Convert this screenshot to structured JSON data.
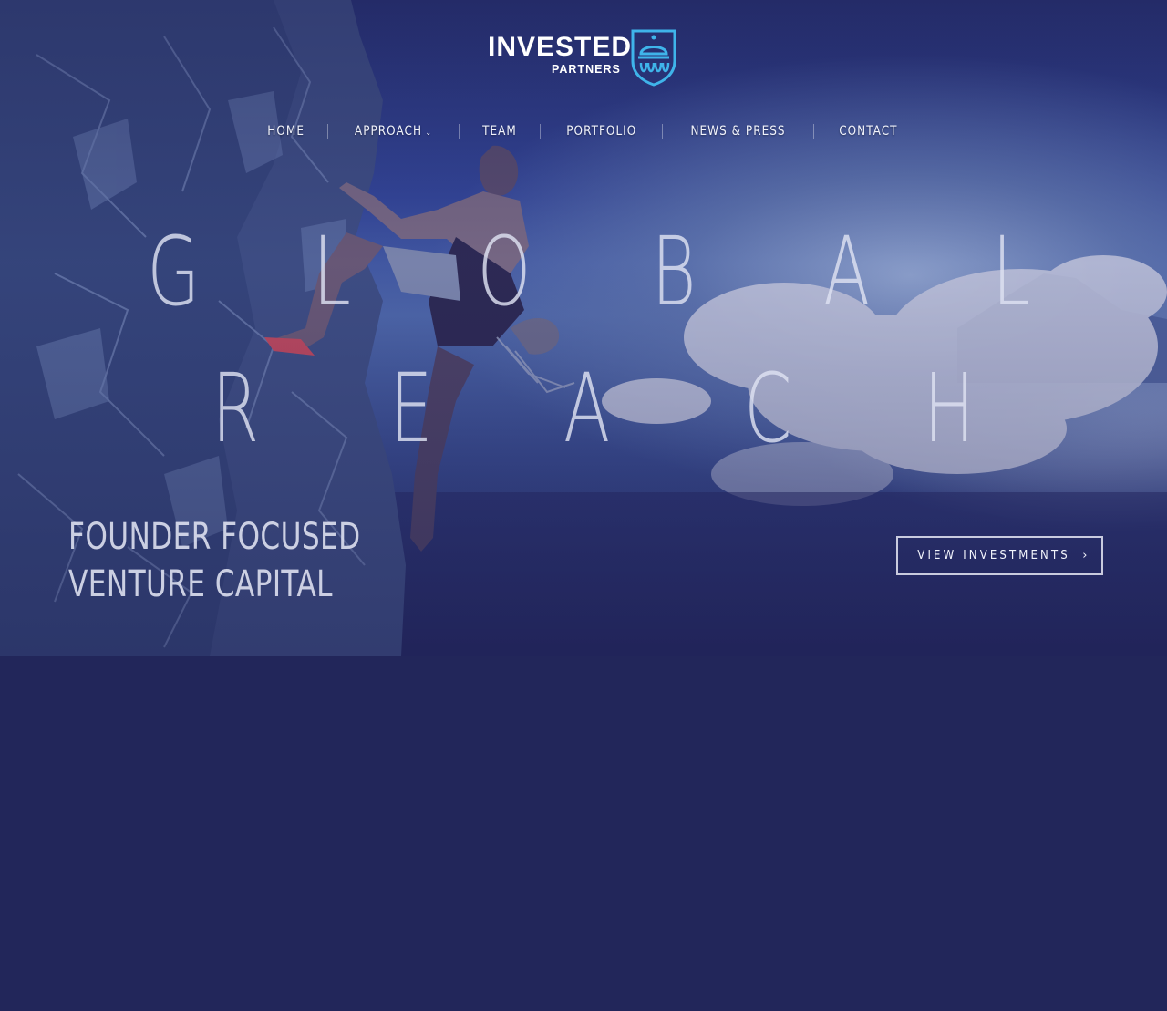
{
  "brand": {
    "name": "INVESTED",
    "sub": "PARTNERS",
    "accent": "#3fb4ea"
  },
  "nav": {
    "items": [
      {
        "label": "HOME"
      },
      {
        "label": "APPROACH",
        "caret": "⌄"
      },
      {
        "label": "TEAM"
      },
      {
        "label": "PORTFOLIO"
      },
      {
        "label": "NEWS & PRESS"
      },
      {
        "label": "CONTACT"
      }
    ]
  },
  "hero": {
    "line1": [
      "G",
      "L",
      "O",
      "B",
      "A",
      "L"
    ],
    "line2": [
      "R",
      "E",
      "A",
      "C",
      "H"
    ]
  },
  "tagline": {
    "line1": "FOUNDER FOCUSED",
    "line2": "VENTURE CAPITAL"
  },
  "cta": {
    "label": "VIEW INVESTMENTS",
    "icon": "chevron-right-icon",
    "glyph": "›"
  },
  "colors": {
    "overlay": "#22265a",
    "text": "#e2e5f2"
  }
}
